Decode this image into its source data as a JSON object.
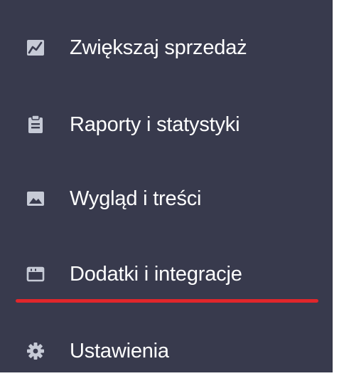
{
  "sidebar": {
    "items": [
      {
        "label": "Zwiększaj sprzedaż",
        "icon": "chart-line-icon"
      },
      {
        "label": "Raporty i statystyki",
        "icon": "clipboard-icon"
      },
      {
        "label": "Wygląd i treści",
        "icon": "image-icon"
      },
      {
        "label": "Dodatki i integracje",
        "icon": "window-icon"
      },
      {
        "label": "Ustawienia",
        "icon": "gear-icon"
      }
    ]
  },
  "colors": {
    "sidebar_bg": "#383a4d",
    "icon": "#c6cad6",
    "text": "#ffffff",
    "highlight_underline": "#e0262b"
  }
}
